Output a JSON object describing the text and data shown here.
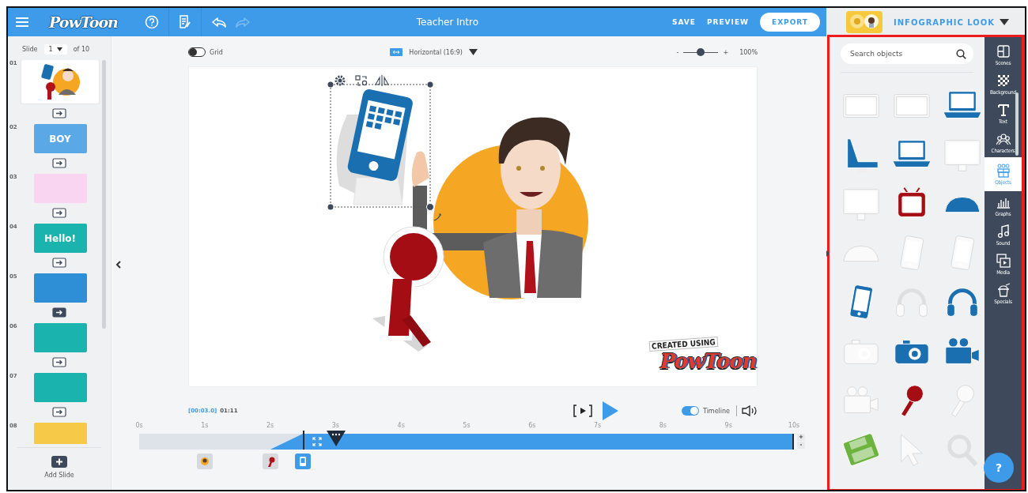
{
  "header": {
    "logo": "PowToon",
    "title": "Teacher Intro",
    "history": {
      "undo_disabled": false,
      "redo_disabled": true
    },
    "actions": [
      "SAVE",
      "PREVIEW"
    ],
    "export": "EXPORT",
    "style": "INFOGRAPHIC LOOK"
  },
  "slides": {
    "label": "Slide",
    "current": "1",
    "total": "of 10",
    "add_slide": "Add Slide",
    "items": [
      {
        "number": "01",
        "selected": true,
        "color": "#ffffff",
        "transition_set": false
      },
      {
        "number": "02",
        "selected": false,
        "color": "#5aa9e6",
        "text": "BOY",
        "transition_set": false
      },
      {
        "number": "03",
        "selected": false,
        "color": "#f9d5f2",
        "transition_set": false
      },
      {
        "number": "04",
        "selected": false,
        "color": "#1bb3ad",
        "text": "Hello!",
        "transition_set": false
      },
      {
        "number": "05",
        "selected": false,
        "color": "#2f8fd6",
        "transition_set": true
      },
      {
        "number": "06",
        "selected": false,
        "color": "#1bb3ad",
        "transition_set": false
      },
      {
        "number": "07",
        "selected": false,
        "color": "#1bb3ad",
        "transition_set": false
      },
      {
        "number": "08",
        "selected": false,
        "color": "#f7c948"
      }
    ]
  },
  "stage": {
    "grid": {
      "label": "Grid",
      "on": false
    },
    "aspect": "Horizontal (16:9)",
    "zoom": {
      "minus": "-",
      "plus": "+",
      "level": 0.5,
      "reading": "100%"
    },
    "watermark": {
      "line1": "CREATED USING",
      "line2": "PowToon"
    }
  },
  "player": {
    "elapsed": "[00:03.0]",
    "duration": "01:11",
    "timeline": {
      "label": "Timeline",
      "on": true
    }
  },
  "timeline": {
    "ticks": [
      "0s",
      "1s",
      "2s",
      "3s",
      "4s",
      "5s",
      "6s",
      "7s",
      "8s",
      "9s",
      "10s"
    ],
    "level": 0.3,
    "zoom_in": "+",
    "zoom_out": "-",
    "layers": [
      {
        "kind": "character",
        "selected": false
      },
      {
        "kind": "ribbon",
        "selected": false
      },
      {
        "kind": "phone",
        "selected": true
      }
    ]
  },
  "objects": {
    "placeholder": "Search objects",
    "items": [
      {
        "kind": "screen",
        "disabled": true
      },
      {
        "kind": "screen",
        "disabled": true
      },
      {
        "kind": "laptop",
        "disabled": false
      },
      {
        "kind": "laptop-side",
        "disabled": false
      },
      {
        "kind": "laptop",
        "disabled": false
      },
      {
        "kind": "monitor",
        "disabled": true
      },
      {
        "kind": "monitor",
        "disabled": true
      },
      {
        "kind": "tv",
        "disabled": false
      },
      {
        "kind": "mouse",
        "disabled": false
      },
      {
        "kind": "mouse",
        "disabled": true
      },
      {
        "kind": "phone",
        "disabled": true
      },
      {
        "kind": "phone",
        "disabled": true
      },
      {
        "kind": "phone",
        "disabled": false
      },
      {
        "kind": "headphones",
        "disabled": true
      },
      {
        "kind": "headphones",
        "disabled": false
      },
      {
        "kind": "camera",
        "disabled": true
      },
      {
        "kind": "camera",
        "disabled": false
      },
      {
        "kind": "video-camera",
        "disabled": false
      },
      {
        "kind": "video-camera",
        "disabled": true
      },
      {
        "kind": "microphone",
        "disabled": false
      },
      {
        "kind": "microphone",
        "disabled": true
      },
      {
        "kind": "floppy",
        "disabled": false
      },
      {
        "kind": "cursor",
        "disabled": true
      },
      {
        "kind": "magnifier",
        "disabled": true
      }
    ]
  },
  "nav": {
    "items": [
      {
        "label": "Scenes",
        "kind": "scenes",
        "selected": false
      },
      {
        "label": "Background",
        "kind": "background",
        "selected": false
      },
      {
        "label": "Text",
        "kind": "text",
        "selected": false
      },
      {
        "label": "Characters",
        "kind": "characters",
        "selected": false
      },
      {
        "label": "Objects",
        "kind": "objects",
        "selected": true
      },
      {
        "label": "Graphs",
        "kind": "graphs",
        "selected": false
      },
      {
        "label": "Sound",
        "kind": "sound",
        "selected": false
      },
      {
        "label": "Media",
        "kind": "media",
        "selected": false
      },
      {
        "label": "Specials",
        "kind": "specials",
        "selected": false
      }
    ]
  },
  "help": "?"
}
